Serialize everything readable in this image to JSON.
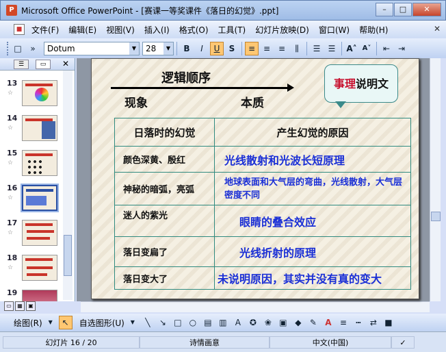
{
  "window": {
    "title": "Microsoft Office PowerPoint - [赛课一等奖课件《落日的幻觉》.ppt]",
    "app_icon": "P"
  },
  "menu": {
    "items": [
      "文件(F)",
      "编辑(E)",
      "视图(V)",
      "插入(I)",
      "格式(O)",
      "工具(T)",
      "幻灯片放映(D)",
      "窗口(W)",
      "帮助(H)"
    ]
  },
  "toolbar": {
    "font": "Dotum",
    "size": "28",
    "bold": "B",
    "italic": "I",
    "underline": "U",
    "shadow": "S"
  },
  "slides_pane": {
    "slides": [
      {
        "num": "13"
      },
      {
        "num": "14"
      },
      {
        "num": "15"
      },
      {
        "num": "16",
        "selected": true
      },
      {
        "num": "17"
      },
      {
        "num": "18"
      },
      {
        "num": "19"
      }
    ]
  },
  "slide": {
    "heading_order": "逻辑顺序",
    "phenomenon": "现象",
    "essence": "本质",
    "callout_red": "事理",
    "callout_dark": "说明文",
    "table": {
      "headers": [
        "日落时的幻觉",
        "产生幻觉的原因"
      ],
      "rows": [
        [
          "颜色深黄、殷红",
          "光线散射和光波长短原理"
        ],
        [
          "神秘的暗弧，亮弧",
          "地球表面和大气层的弯曲，光线散射，大气层密度不同"
        ],
        [
          "迷人的紫光",
          "眼睛的叠合效应"
        ],
        [
          "落日变扁了",
          "光线折射的原理"
        ],
        [
          "落日变大了",
          "未说明原因，其实并没有真的变大"
        ]
      ]
    }
  },
  "drawbar": {
    "draw": "绘图(R)",
    "autoshapes": "自选图形(U)"
  },
  "status": {
    "slide": "幻灯片 16 / 20",
    "design": "诗情画意",
    "language": "中文(中国)"
  }
}
